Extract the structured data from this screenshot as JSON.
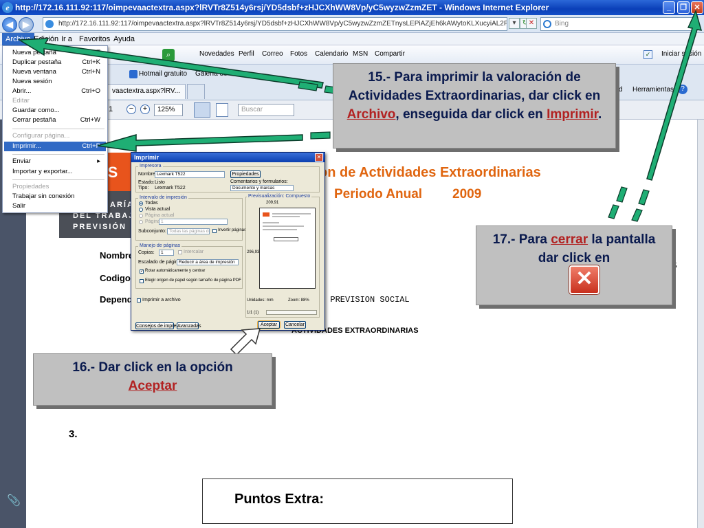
{
  "window": {
    "title": "http://172.16.111.92:117/oimpevaactextra.aspx?lRVTr8Z514y6rsj/YD5dsbf+zHJCXhWW8Vp/yC5wyzwZzmZET - Windows Internet Explorer",
    "minimize_icon": "minimize-icon",
    "maximize_icon": "maximize-icon",
    "close_icon": "close-icon"
  },
  "address_bar": {
    "url": "http://172.16.111.92:117/oimpevaactextra.aspx?lRVTr8Z514y6rsj/YD5dsbf+zHJCXhWW8Vp/yC5wyzwZzmZETnysLEPiAZjEh6kAWytoKLXucyiAL2PmEtxdmv/mo1md5",
    "search_placeholder": "Bing"
  },
  "menubar": {
    "items": [
      "Archivo",
      "Edición",
      "Ir a",
      "Favoritos",
      "Ayuda"
    ]
  },
  "links_toolbar": {
    "items": [
      "Novedades",
      "Perfil",
      "Correo",
      "Fotos",
      "Calendario",
      "MSN",
      "Compartir"
    ],
    "signin": "Iniciar sesión"
  },
  "tabs_row": {
    "fav_hotmail": "Hotmail gratuito",
    "fav_gallery": "Galería de",
    "tab_label": "vaactextra.aspx?lRV...",
    "tools_label": "Herramientas",
    "page_label": "d"
  },
  "pdf_toolbar": {
    "page": "1",
    "zoom": "125%",
    "search": "Buscar"
  },
  "file_menu": {
    "items": [
      {
        "label": "Nueva pestaña",
        "shortcut": "Ctrl+T"
      },
      {
        "label": "Duplicar pestaña",
        "shortcut": "Ctrl+K"
      },
      {
        "label": "Nueva ventana",
        "shortcut": "Ctrl+N"
      },
      {
        "label": "Nueva sesión",
        "shortcut": ""
      },
      {
        "label": "Abrir...",
        "shortcut": "Ctrl+O"
      },
      {
        "label": "Editar",
        "shortcut": ""
      },
      {
        "label": "Guardar como...",
        "shortcut": ""
      },
      {
        "label": "Cerrar pestaña",
        "shortcut": "Ctrl+W"
      },
      {
        "label": "Configurar página...",
        "shortcut": ""
      },
      {
        "label": "Imprimir...",
        "shortcut": "Ctrl+P"
      },
      {
        "label": "Enviar",
        "shortcut": "▸"
      },
      {
        "label": "Importar y exportar...",
        "shortcut": ""
      },
      {
        "label": "Propiedades",
        "shortcut": ""
      },
      {
        "label": "Trabajar sin conexión",
        "shortcut": ""
      },
      {
        "label": "Salir",
        "shortcut": ""
      }
    ]
  },
  "print_dialog": {
    "title": "Imprimir",
    "printer_group": "Impresora",
    "name_label": "Nombre:",
    "name_value": "Lexmark T522",
    "properties_button": "Propiedades",
    "status_label": "Estado:",
    "status_value": "Listo",
    "type_label": "Tipo:",
    "type_value": "Lexmark T522",
    "comments_label": "Comentarios y formularios:",
    "comments_value": "Documento y marcas",
    "range_group": "Intervalo de impresión",
    "range_all": "Todas",
    "range_current_view": "Vista actual",
    "range_current_page": "Página actual",
    "range_pages": "Páginas",
    "pages_value": "1",
    "subset_label": "Subconjunto:",
    "subset_value": "Todas las páginas del rango",
    "reverse_pages": "Invertir páginas",
    "handling_group": "Manejo de páginas",
    "copies_label": "Copias:",
    "copies_value": "1",
    "collate": "Intercalar",
    "scaling_label": "Escalado de página:",
    "scaling_value": "Reducir a área de impresión",
    "auto_rotate": "Rotar automáticamente y centrar",
    "choose_source": "Elegir origen de papel según tamaño de página PDF",
    "print_to_file": "Imprimir a archivo",
    "preview_group": "Previsualización: Compuesto",
    "preview_width": "209,91",
    "preview_height": "296,93",
    "units_label": "Unidades: mm",
    "zoom_label": "Zoom: 88%",
    "page_count": "1/1 (1)",
    "tips_button": "Consejos de impresión",
    "advanced_button": "Avanzadas",
    "ok_button": "Aceptar",
    "cancel_button": "Cancelar"
  },
  "document": {
    "title_line1": "on de Actividades Extraordinarias",
    "title_line2": "Periodo Anual",
    "title_year": "2009",
    "logo_top": "PS",
    "logo_lines": [
      "ARÍA",
      "DEL TRABAJ",
      "PREVISIÓN"
    ],
    "label_nombre": "Nombre",
    "label_codigo": "Codigo",
    "label_depend": "Depend",
    "value_codigo_tail": "M",
    "value_depend_tail": "Y PREVISION SOCIAL",
    "section_heading": "ACTIVIDADES EXTRAORDINARIAS",
    "item_number": "3.",
    "puntos_extra": "Puntos Extra:",
    "right_edge_char": "S"
  },
  "callouts": {
    "step15_pre": "15.- Para imprimir la valoración de Actividades Extraordinarias, dar click en ",
    "step15_link1": "Archivo",
    "step15_mid": ", enseguida dar click en ",
    "step15_link2": "Imprimir",
    "step15_post": ".",
    "step16_text": "16.- Dar click en la opción",
    "step16_link": "Aceptar",
    "step17_pre": "17.- Para ",
    "step17_link": "cerrar",
    "step17_post": " la pantalla dar click en"
  },
  "colors": {
    "arrow_green": "#1fae74",
    "arrow_outline": "#0b3b2a",
    "doc_orange": "#e0650f",
    "callout_bg": "#c0c0c0",
    "link_red": "#b22222"
  }
}
